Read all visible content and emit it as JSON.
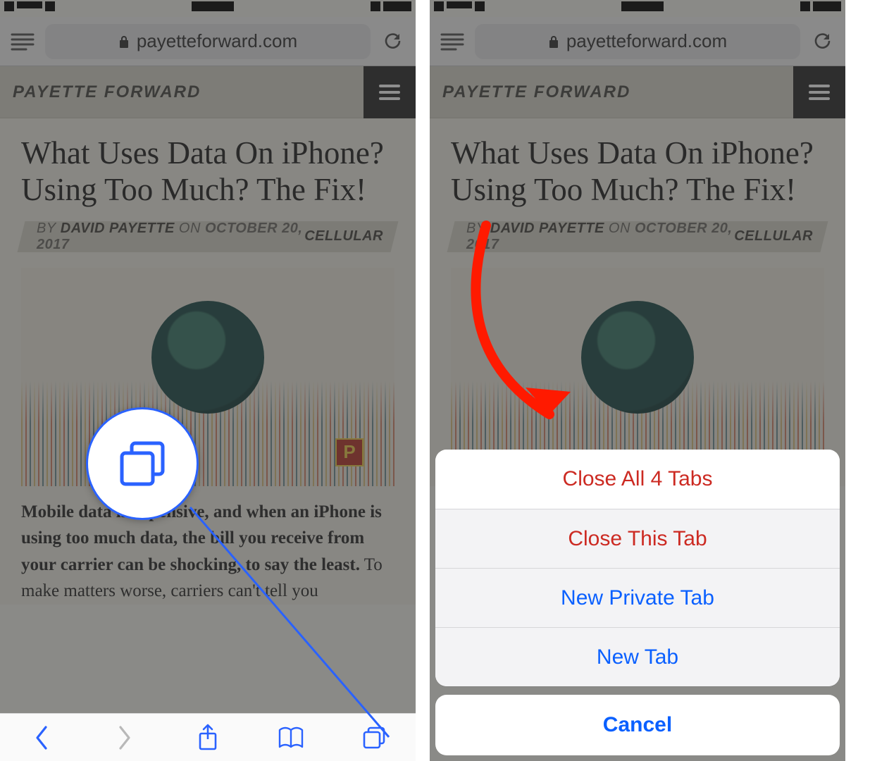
{
  "browser": {
    "domain": "payetteforward.com"
  },
  "site": {
    "title": "PAYETTE FORWARD"
  },
  "article": {
    "headline": "What Uses Data On iPhone? Using Too Much? The Fix!",
    "byline_by": "BY",
    "byline_author": "DAVID PAYETTE",
    "byline_on": "ON",
    "byline_date": "OCTOBER 20, 2017",
    "category": "CELLULAR",
    "body_bold": "Mobile data is expensive, and when an iPhone is using too much data, the bill you receive from your carrier can be shocking, to say the least.",
    "body_rest": " To make matters worse, carriers can't tell you",
    "p_badge": "P"
  },
  "action_sheet": {
    "close_all": "Close All 4 Tabs",
    "close_this": "Close This Tab",
    "new_private": "New Private Tab",
    "new_tab": "New Tab",
    "cancel": "Cancel"
  }
}
